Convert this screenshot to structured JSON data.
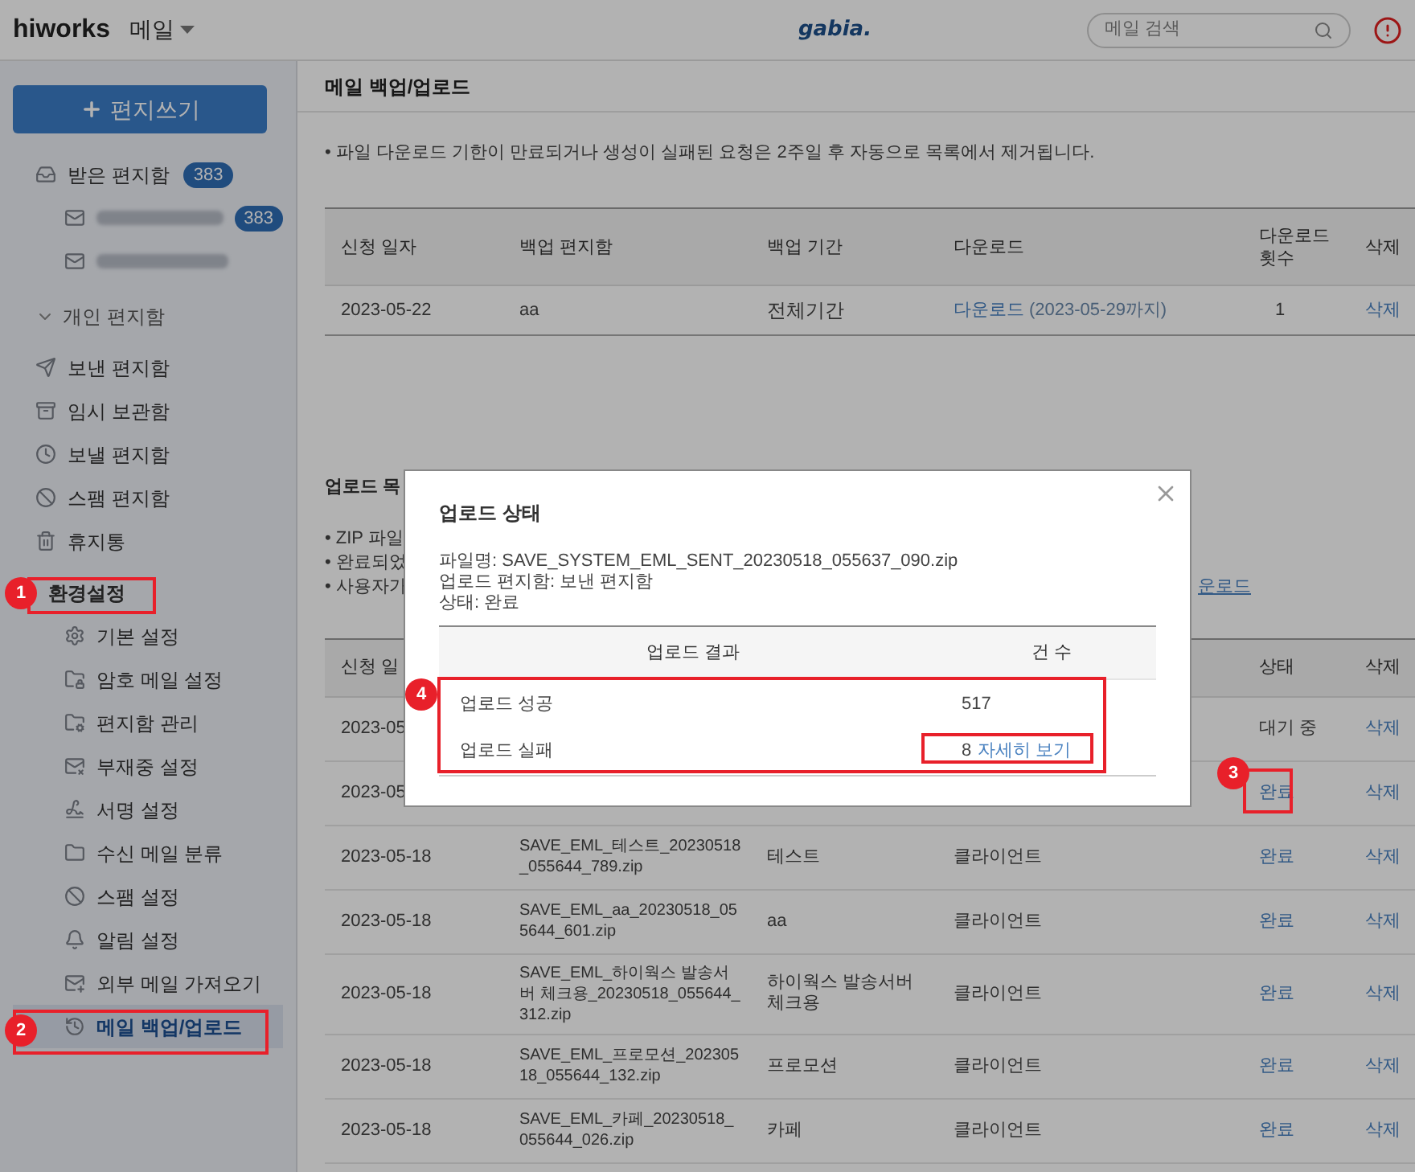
{
  "topbar": {
    "logo": "hiworks",
    "app_menu": "메일",
    "brand": "gabia.",
    "search": {
      "placeholder": "메일 검색"
    }
  },
  "sidebar": {
    "compose": "편지쓰기",
    "items": [
      {
        "kind": "folder",
        "label": "받은 편지함",
        "badge": "383",
        "selected": false
      },
      {
        "kind": "account",
        "badge": "383",
        "selected": false
      },
      {
        "kind": "account",
        "selected": false
      },
      {
        "kind": "group",
        "label": "개인 편지함",
        "expanded": true
      },
      {
        "kind": "folder",
        "label": "보낸 편지함",
        "selected": false
      },
      {
        "kind": "folder",
        "label": "임시 보관함",
        "selected": false
      },
      {
        "kind": "folder",
        "label": "보낼 편지함",
        "selected": false
      },
      {
        "kind": "folder",
        "label": "스팸 편지함",
        "selected": false
      },
      {
        "kind": "folder",
        "label": "휴지통",
        "selected": false
      },
      {
        "kind": "section",
        "label": "환경설정"
      },
      {
        "kind": "setting",
        "label": "기본 설정",
        "selected": false
      },
      {
        "kind": "setting",
        "label": "암호 메일 설정",
        "selected": false
      },
      {
        "kind": "setting",
        "label": "편지함 관리",
        "selected": false
      },
      {
        "kind": "setting",
        "label": "부재중 설정",
        "selected": false
      },
      {
        "kind": "setting",
        "label": "서명 설정",
        "selected": false
      },
      {
        "kind": "setting",
        "label": "수신 메일 분류",
        "selected": false
      },
      {
        "kind": "setting",
        "label": "스팸 설정",
        "selected": false
      },
      {
        "kind": "setting",
        "label": "알림 설정",
        "selected": false
      },
      {
        "kind": "setting",
        "label": "외부 메일 가져오기",
        "selected": false
      },
      {
        "kind": "setting",
        "label": "메일 백업/업로드",
        "selected": true
      }
    ]
  },
  "main": {
    "title": "메일 백업/업로드",
    "notices": [
      "• 파일 다운로드 기한이 만료되거나 생성이 실패된 요청은 2주일 후 자동으로 목록에서 제거됩니다."
    ],
    "backup_table": {
      "columns": [
        "신청 일자",
        "백업 편지함",
        "백업 기간",
        "다운로드",
        "다운로드 횟수",
        "삭제"
      ],
      "rows": [
        {
          "date": "2023-05-22",
          "mailbox": "aa",
          "period": "전체기간",
          "download": "다운로드",
          "download_note": "(2023-05-29까지)",
          "count": "1",
          "delete": "삭제"
        }
      ]
    },
    "upload_section": {
      "title": "업로드 목",
      "notices": [
        "• ZIP 파일",
        "• 완료되었",
        "• 사용자가"
      ],
      "link": "운로드"
    },
    "upload_table": {
      "columns": [
        "신청 일",
        "상태",
        "삭제"
      ],
      "rows": [
        {
          "date": "2023-05",
          "status": "대기 중",
          "status_done": false,
          "delete": "삭제"
        },
        {
          "date": "2023-05",
          "status": "완료",
          "status_done": true,
          "delete": "삭제"
        },
        {
          "date": "2023-05-18",
          "file": "SAVE_EML_테스트_20230518_055644_789.zip",
          "mailbox": "테스트",
          "source": "클라이언트",
          "status": "완료",
          "status_done": true,
          "delete": "삭제"
        },
        {
          "date": "2023-05-18",
          "file": "SAVE_EML_aa_20230518_055644_601.zip",
          "mailbox": "aa",
          "source": "클라이언트",
          "status": "완료",
          "status_done": true,
          "delete": "삭제"
        },
        {
          "date": "2023-05-18",
          "file": "SAVE_EML_하이웍스 발송서버 체크용_20230518_055644_312.zip",
          "mailbox": "하이웍스 발송서버 체크용",
          "source": "클라이언트",
          "status": "완료",
          "status_done": true,
          "delete": "삭제"
        },
        {
          "date": "2023-05-18",
          "file": "SAVE_EML_프로모션_20230518_055644_132.zip",
          "mailbox": "프로모션",
          "source": "클라이언트",
          "status": "완료",
          "status_done": true,
          "delete": "삭제"
        },
        {
          "date": "2023-05-18",
          "file": "SAVE_EML_카페_20230518_055644_026.zip",
          "mailbox": "카페",
          "source": "클라이언트",
          "status": "완료",
          "status_done": true,
          "delete": "삭제"
        }
      ]
    }
  },
  "modal": {
    "title": "업로드 상태",
    "lines": [
      "파일명: SAVE_SYSTEM_EML_SENT_20230518_055637_090.zip",
      "업로드 편지함: 보낸 편지함",
      "상태: 완료"
    ],
    "columns": [
      "업로드 결과",
      "건 수"
    ],
    "rows": [
      {
        "label": "업로드 성공",
        "count": "517"
      },
      {
        "label": "업로드 실패",
        "count": "8",
        "link": "자세히 보기"
      }
    ]
  },
  "annotations": [
    {
      "number": "1"
    },
    {
      "number": "2"
    },
    {
      "number": "3"
    },
    {
      "number": "4"
    }
  ]
}
